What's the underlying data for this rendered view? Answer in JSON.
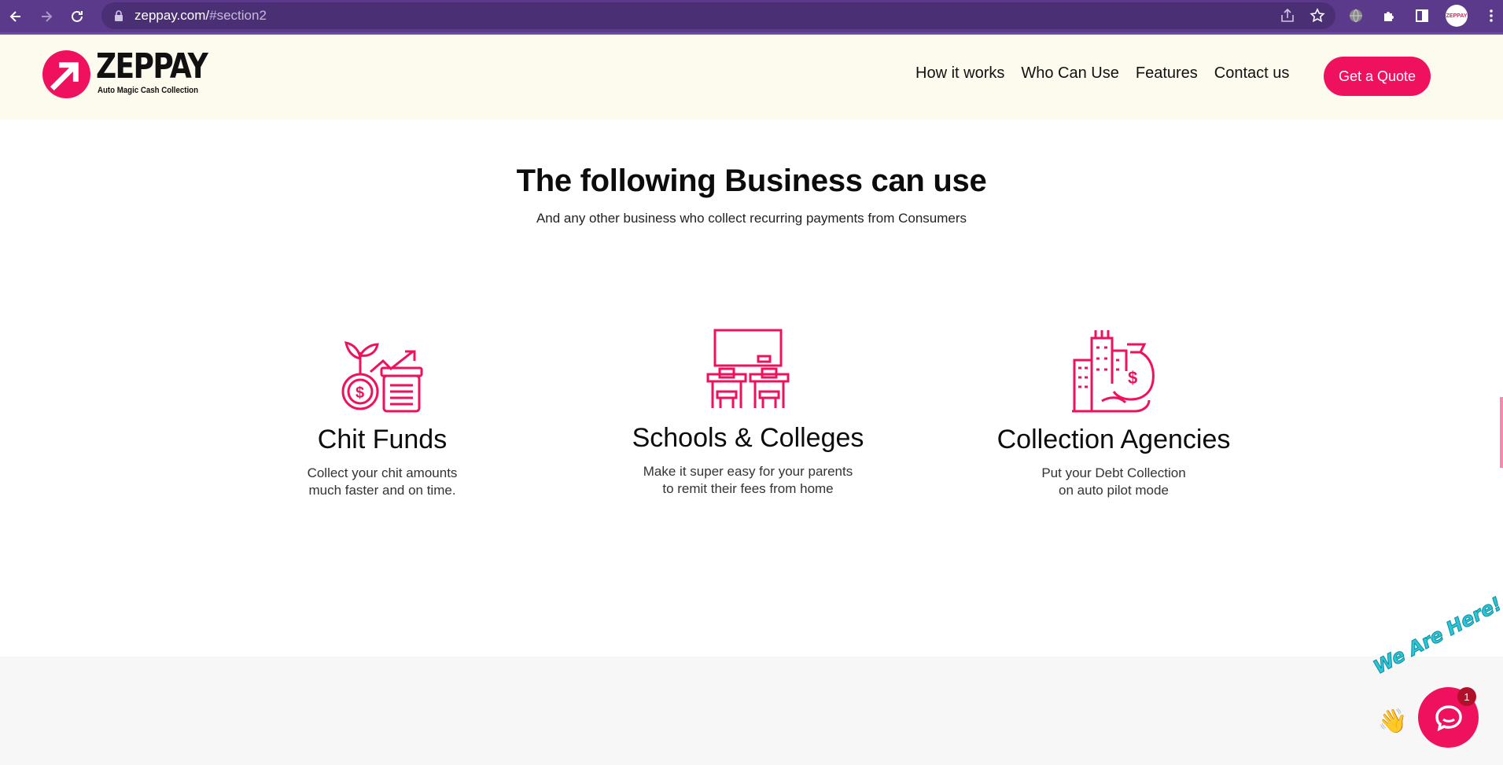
{
  "browser": {
    "url_main": "zeppay.com/",
    "url_hash": "#section2",
    "profile_label": "ZEPPAY"
  },
  "header": {
    "logo_name": "ZEPPAY",
    "logo_tagline": "Auto Magic Cash Collection",
    "nav": [
      "How it works",
      "Who Can Use",
      "Features",
      "Contact us"
    ],
    "cta": "Get a Quote"
  },
  "section": {
    "title": "The following Business can use",
    "subtitle": "And any other business who collect recurring payments from Consumers"
  },
  "cards": [
    {
      "icon": "chit-fund-icon",
      "title": "Chit Funds",
      "line1": "Collect your chit amounts",
      "line2": "much faster and on time."
    },
    {
      "icon": "classroom-icon",
      "title": "Schools & Colleges",
      "line1": "Make it super easy for your parents",
      "line2": "to remit their fees from home"
    },
    {
      "icon": "money-bag-city-icon",
      "title": "Collection Agencies",
      "line1": "Put your Debt Collection",
      "line2": "on auto pilot mode"
    }
  ],
  "chat": {
    "tagline": "We Are Here!",
    "badge": "1"
  },
  "colors": {
    "brand": "#f0115e",
    "header_bg": "#fdfbee",
    "browser": "#5b3a8c"
  }
}
